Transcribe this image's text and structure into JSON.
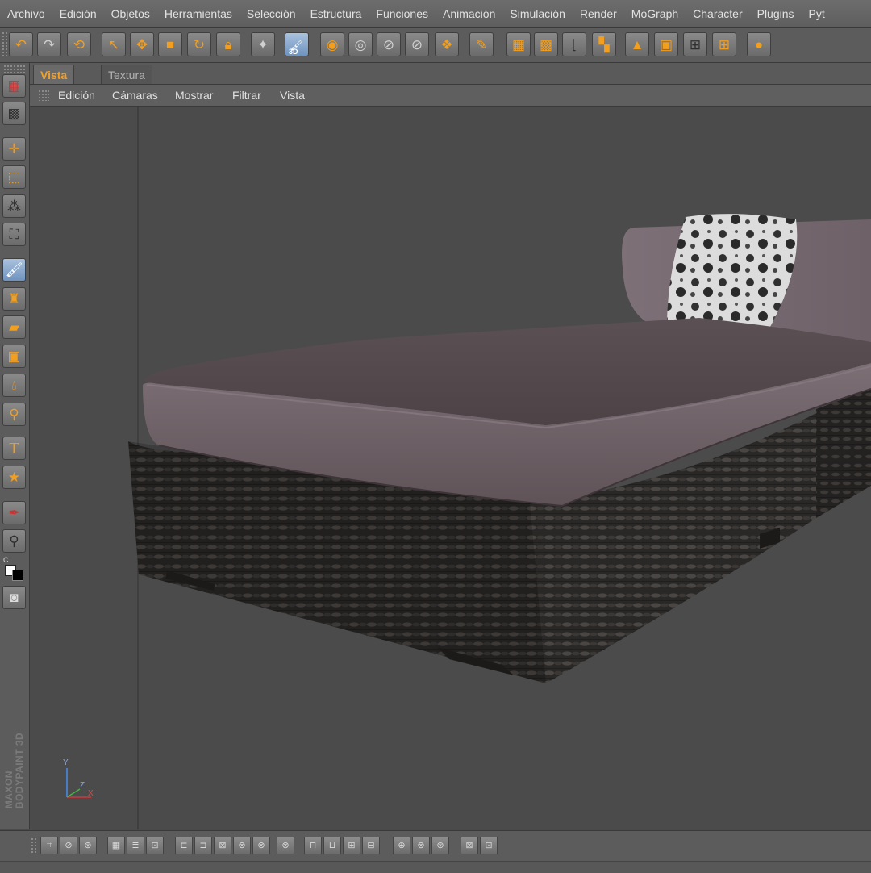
{
  "menu": [
    "Archivo",
    "Edición",
    "Objetos",
    "Herramientas",
    "Selección",
    "Estructura",
    "Funciones",
    "Animación",
    "Simulación",
    "Render",
    "MoGraph",
    "Character",
    "Plugins",
    "Pyt"
  ],
  "tabs": {
    "active": "Vista",
    "inactive": "Textura"
  },
  "viewport_menu": [
    "Edición",
    "Cámaras",
    "Mostrar",
    "Filtrar",
    "Vista"
  ],
  "toolbar": {
    "undo_icon": "undo-icon",
    "redo_icon": "redo-icon",
    "badge_3d": "3D"
  },
  "left_tools": {
    "text_tool_glyph": "T",
    "color_label": "C"
  },
  "axis": {
    "y": "Y",
    "z": "Z",
    "x": "X"
  },
  "brand": {
    "line1": "MAXON",
    "line2": "BODYPAINT 3D"
  },
  "colors": {
    "accent": "#f29e1f",
    "cushion": "#5e5157",
    "wicker": "#2c2a29",
    "pillow": "#d9d9d9",
    "viewport_bg": "#4b4b4b"
  }
}
